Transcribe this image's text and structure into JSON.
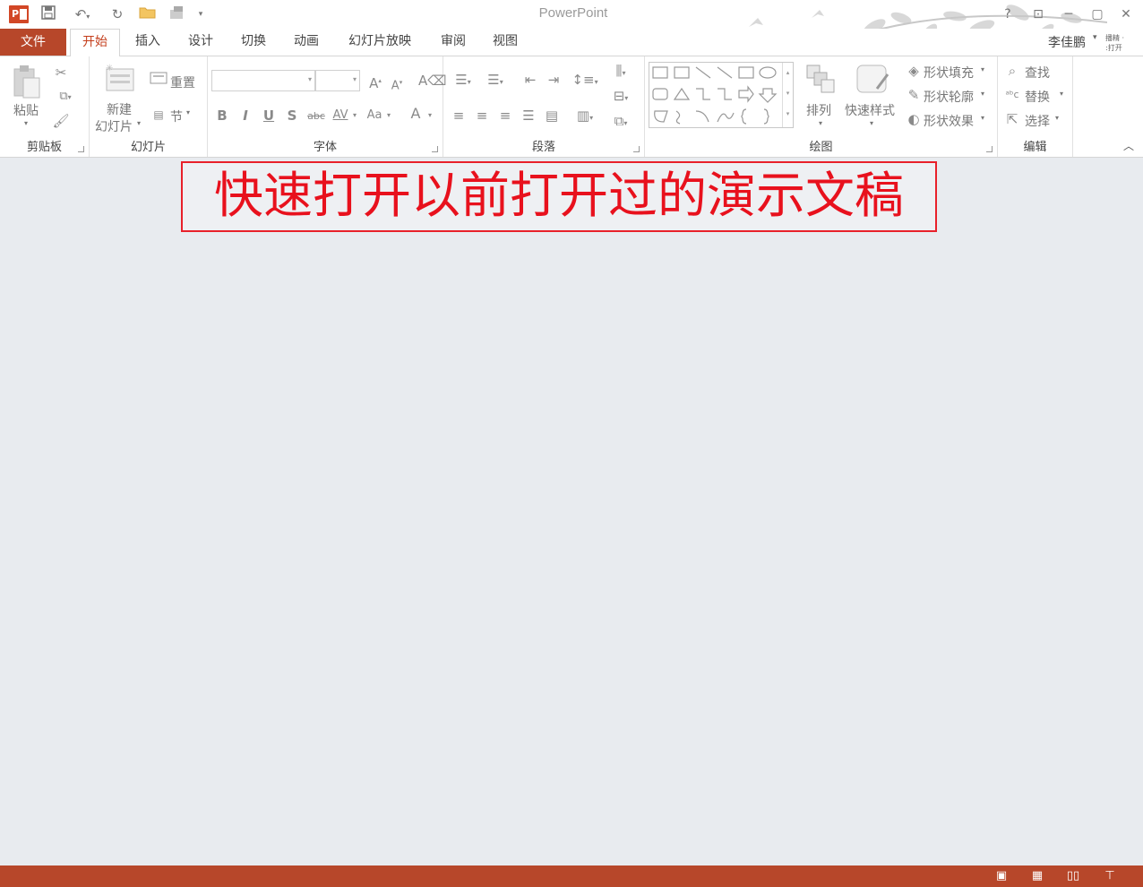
{
  "window": {
    "title": "PowerPoint"
  },
  "quick_access": {
    "save": "save-icon",
    "undo": "undo-icon",
    "redo": "redo-icon",
    "open": "open-folder-icon",
    "new": "new-slide-icon"
  },
  "tabs": [
    "文件",
    "开始",
    "插入",
    "设计",
    "切换",
    "动画",
    "幻灯片放映",
    "审阅",
    "视图"
  ],
  "user": {
    "name": "李佳鹏",
    "avatar_text": "播精 ·\n:打开"
  },
  "ribbon": {
    "clipboard": {
      "label": "剪贴板",
      "paste": "粘贴"
    },
    "slides": {
      "label": "幻灯片",
      "new_slide_line1": "新建",
      "new_slide_line2": "幻灯片",
      "reset": "重置",
      "section": "节"
    },
    "font": {
      "label": "字体",
      "bold": "B",
      "italic": "I",
      "underline": "U",
      "shadow": "S",
      "strike": "abc",
      "spacing": "AV",
      "case": "Aa",
      "color": "A"
    },
    "paragraph": {
      "label": "段落"
    },
    "drawing": {
      "label": "绘图",
      "arrange": "排列",
      "quick_styles": "快速样式",
      "shape_fill": "形状填充",
      "shape_outline": "形状轮廓",
      "shape_effects": "形状效果"
    },
    "editing": {
      "label": "编辑",
      "find": "查找",
      "replace": "替换",
      "select": "选择"
    }
  },
  "banner": {
    "text": "快速打开以前打开过的演示文稿"
  },
  "colors": {
    "accent": "#b7472a",
    "banner_border": "#e8202a",
    "banner_text": "#e8111d",
    "workspace": "#e8ebef"
  }
}
